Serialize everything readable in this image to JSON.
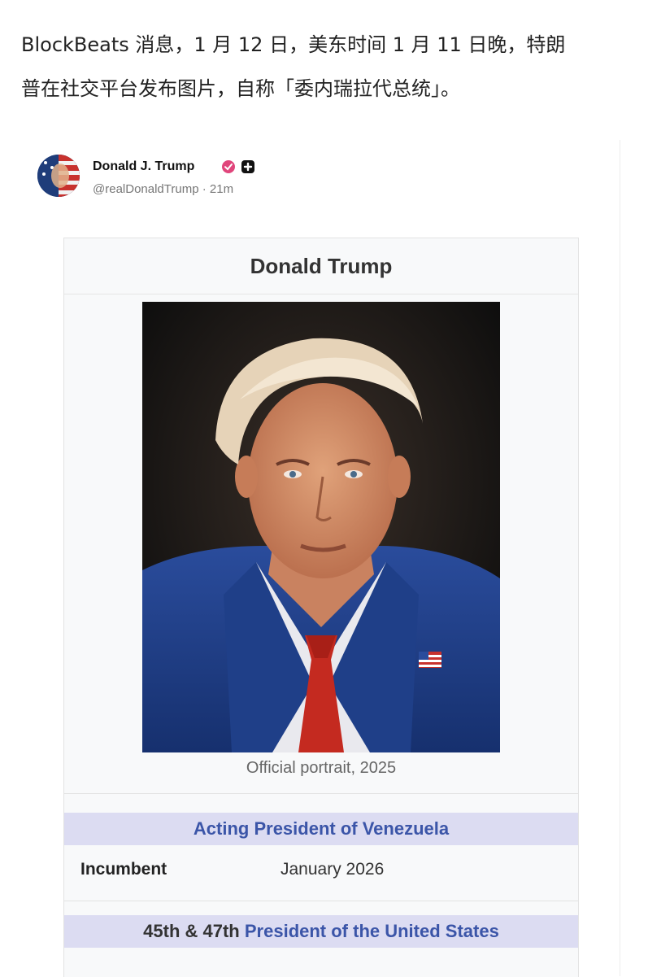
{
  "article": {
    "line1": "BlockBeats 消息，1 月 12 日，美东时间 1 月 11 日晚，特朗",
    "line2": "普在社交平台发布图片，自称「委内瑞拉代总统」。"
  },
  "post": {
    "author_name": "Donald J. Trump",
    "handle_time": "@realDonaldTrump · 21m",
    "icons": [
      "verified-badge-icon",
      "plus-badge-icon"
    ]
  },
  "infobox": {
    "title": "Donald Trump",
    "caption": "Official portrait, 2025",
    "section1": "Acting President of Venezuela",
    "incumbent_label": "Incumbent",
    "incumbent_value": "January 2026",
    "section2_prefix": "45th & 47th",
    "section2_link": "President of the United States"
  },
  "colors": {
    "link": "#3b55a8",
    "section_bg": "#dcdcf2",
    "verified": "#e0457b"
  }
}
